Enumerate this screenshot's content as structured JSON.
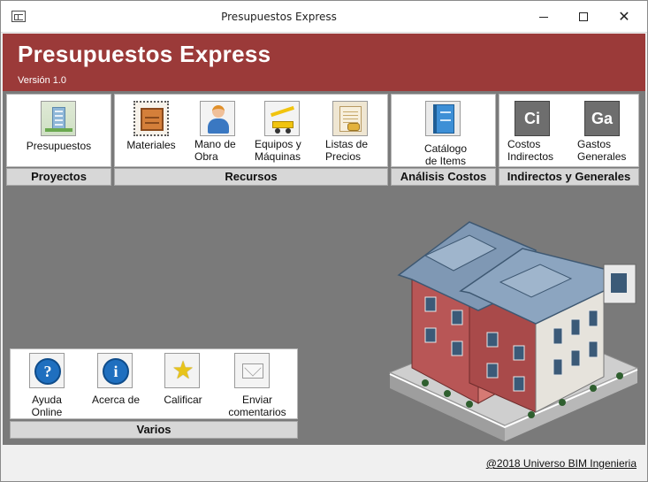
{
  "window": {
    "title": "Presupuestos Express"
  },
  "header": {
    "title": "Presupuestos Express",
    "version": "Versión 1.0"
  },
  "groups": {
    "proyectos": {
      "label": "Proyectos",
      "items": [
        {
          "label": "Presupuestos",
          "icon": "building-icon"
        }
      ]
    },
    "recursos": {
      "label": "Recursos",
      "items": [
        {
          "label": "Materiales",
          "icon": "crate-icon"
        },
        {
          "label": "Mano de Obra",
          "icon": "worker-icon"
        },
        {
          "label": "Equipos y Máquinas",
          "icon": "crane-truck-icon"
        },
        {
          "label": "Listas de Precios",
          "icon": "price-list-icon"
        }
      ]
    },
    "analisis": {
      "label": "Análisis Costos",
      "items": [
        {
          "label": "Catálogo de Items",
          "icon": "book-icon"
        }
      ]
    },
    "indirectos": {
      "label": "Indirectos y Generales",
      "items": [
        {
          "label": "Costos Indirectos",
          "icon_text": "Ci"
        },
        {
          "label": "Gastos Generales",
          "icon_text": "Ga"
        }
      ]
    },
    "varios": {
      "label": "Varios",
      "items": [
        {
          "label": "Ayuda Online",
          "icon": "help-icon",
          "icon_text": "?"
        },
        {
          "label": "Acerca de",
          "icon": "info-icon",
          "icon_text": "i"
        },
        {
          "label": "Calificar",
          "icon": "star-icon"
        },
        {
          "label": "Enviar comentarios",
          "icon": "mail-icon"
        }
      ]
    }
  },
  "footer": {
    "credit": "@2018 Universo BIM Ingenieria"
  }
}
